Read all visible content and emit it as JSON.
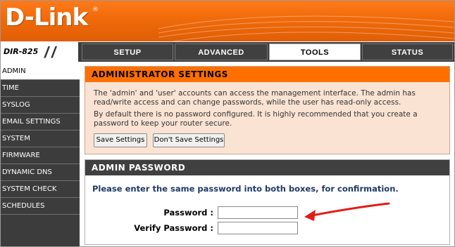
{
  "brand": {
    "logo_text": "D-Link",
    "trademark": "®"
  },
  "model": {
    "label": "DIR-825"
  },
  "nav": {
    "tabs": [
      {
        "label": "SETUP"
      },
      {
        "label": "ADVANCED"
      },
      {
        "label": "TOOLS",
        "active": true
      },
      {
        "label": "STATUS"
      }
    ]
  },
  "sidebar": {
    "items": [
      {
        "label": "ADMIN",
        "active": true
      },
      {
        "label": "TIME"
      },
      {
        "label": "SYSLOG"
      },
      {
        "label": "EMAIL SETTINGS"
      },
      {
        "label": "SYSTEM"
      },
      {
        "label": "FIRMWARE"
      },
      {
        "label": "DYNAMIC DNS"
      },
      {
        "label": "SYSTEM CHECK"
      },
      {
        "label": "SCHEDULES"
      }
    ]
  },
  "admin_settings": {
    "title": "ADMINISTRATOR SETTINGS",
    "paragraph1": "The 'admin' and 'user' accounts can access the management interface. The admin has read/write access and can change passwords, while the user has read-only access.",
    "paragraph2": "By default there is no password configured. It is highly recommended that you create a password to keep your router secure.",
    "save_label": "Save Settings",
    "dont_save_label": "Don't Save Settings"
  },
  "admin_password": {
    "title": "ADMIN PASSWORD",
    "instruction": "Please enter the same password into both boxes, for confirmation.",
    "password_label": "Password :",
    "verify_label": "Verify Password :",
    "password_value": "",
    "verify_value": ""
  },
  "colors": {
    "brand_orange": "#ff6f00",
    "nav_dark": "#3c3c3c",
    "annotation_arrow": "#e41b17"
  }
}
